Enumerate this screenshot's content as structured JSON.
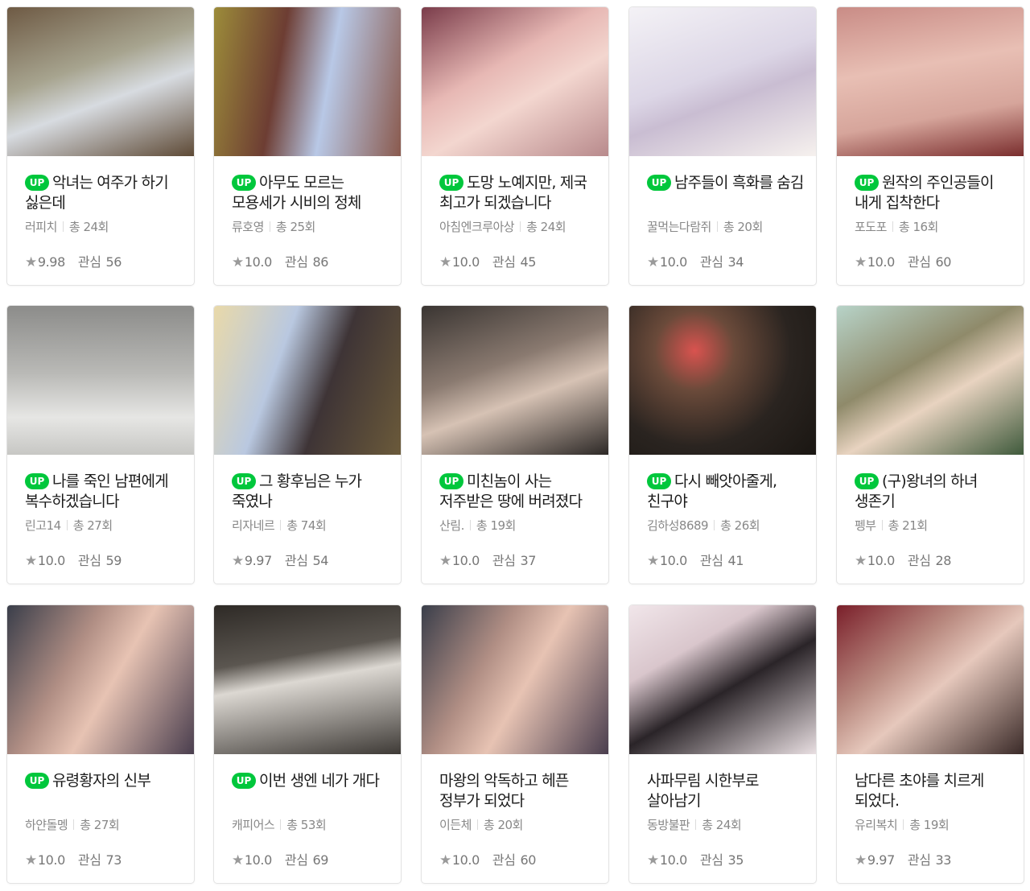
{
  "cards": [
    {
      "up": true,
      "badge": "UP",
      "title": "악녀는 여주가 하기 싫은데",
      "author": "러피치",
      "episodes": "총 24회",
      "rating": "9.98",
      "interest_label": "관심",
      "interest": "56",
      "thumb_gradient": "linear-gradient(160deg,#6e5a44 0%,#a7a48f 40%,#d7dbe0 60%,#5e4a36 100%)"
    },
    {
      "up": true,
      "badge": "UP",
      "title": "아무도 모르는 모용세가 시비의 정체",
      "author": "류호영",
      "episodes": "총 25회",
      "rating": "10.0",
      "interest_label": "관심",
      "interest": "86",
      "thumb_gradient": "linear-gradient(100deg,#9c8c3a 0%,#6d3d33 35%,#b8c8e6 60%,#8a5a4e 100%)"
    },
    {
      "up": true,
      "badge": "UP",
      "title": "도망 노예지만, 제국 최고가 되겠습니다",
      "author": "아침엔크루아상",
      "episodes": "총 24회",
      "rating": "10.0",
      "interest_label": "관심",
      "interest": "45",
      "thumb_gradient": "linear-gradient(150deg,#7a3c4a 0%,#e7b8b4 40%,#f3d6cf 60%,#b88a8c 100%)"
    },
    {
      "up": true,
      "badge": "UP",
      "title": "남주들이 흑화를 숨김",
      "author": "꿀먹는다람쥐",
      "episodes": "총 20회",
      "rating": "10.0",
      "interest_label": "관심",
      "interest": "34",
      "thumb_gradient": "linear-gradient(160deg,#f4f2f6 0%,#dcd6e6 45%,#c9bdd2 60%,#f6f1ee 100%)"
    },
    {
      "up": true,
      "badge": "UP",
      "title": "원작의 주인공들이 내게 집착한다",
      "author": "포도포",
      "episodes": "총 16회",
      "rating": "10.0",
      "interest_label": "관심",
      "interest": "60",
      "thumb_gradient": "linear-gradient(170deg,#c98c86 0%,#e8bfb4 40%,#d6a59b 70%,#7a2e2e 100%)"
    },
    {
      "up": true,
      "badge": "UP",
      "title": "나를 죽인 남편에게 복수하겠습니다",
      "author": "린고14",
      "episodes": "총 27회",
      "rating": "10.0",
      "interest_label": "관심",
      "interest": "59",
      "thumb_gradient": "linear-gradient(180deg,#8c8c8a 0%,#b9b9b6 45%,#e6e6e4 75%,#c7c7c4 100%)"
    },
    {
      "up": true,
      "badge": "UP",
      "title": "그 황후님은 누가 죽였나",
      "author": "리자네르",
      "episodes": "총 74회",
      "rating": "9.97",
      "interest_label": "관심",
      "interest": "54",
      "thumb_gradient": "linear-gradient(110deg,#e9d9a9 0%,#b9c8e0 35%,#3e3436 60%,#6b5a3a 100%)"
    },
    {
      "up": true,
      "badge": "UP",
      "title": "미친놈이 사는 저주받은 땅에 버려졌다",
      "author": "산림.",
      "episodes": "총 19회",
      "rating": "10.0",
      "interest_label": "관심",
      "interest": "37",
      "thumb_gradient": "linear-gradient(160deg,#3a3532 0%,#8a7a70 40%,#d6c2b4 60%,#2c2826 100%)"
    },
    {
      "up": true,
      "badge": "UP",
      "title": "다시 빼앗아줄게, 친구야",
      "author": "김하성8689",
      "episodes": "총 26회",
      "rating": "10.0",
      "interest_label": "관심",
      "interest": "41",
      "thumb_gradient": "radial-gradient(circle at 35% 30%,#d9534f 0%,#6a4a3a 25%,#2a2420 60%,#1a1612 100%)"
    },
    {
      "up": true,
      "badge": "UP",
      "title": "(구)왕녀의 하녀 생존기",
      "author": "펭부",
      "episodes": "총 21회",
      "rating": "10.0",
      "interest_label": "관심",
      "interest": "28",
      "thumb_gradient": "linear-gradient(150deg,#b7d3c8 0%,#8f8a6a 40%,#e8d3c0 60%,#3f5a3c 100%)"
    },
    {
      "up": true,
      "badge": "UP",
      "title": "유령황자의 신부",
      "author": "하얀돌멩",
      "episodes": "총 27회",
      "rating": "10.0",
      "interest_label": "관심",
      "interest": "73",
      "thumb_gradient": "linear-gradient(120deg,#3a3e4a 0%,#b08e84 35%,#e7c3b3 55%,#4a3e4e 100%)"
    },
    {
      "up": true,
      "badge": "UP",
      "title": "이번 생엔 네가 개다",
      "author": "캐피어스",
      "episodes": "총 53회",
      "rating": "10.0",
      "interest_label": "관심",
      "interest": "69",
      "thumb_gradient": "linear-gradient(170deg,#2e2a26 0%,#5b5650 35%,#dcd8d2 50%,#3e3a36 100%)"
    },
    {
      "up": false,
      "badge": "",
      "title": "마왕의 악독하고 헤픈 정부가 되었다",
      "author": "이든체",
      "episodes": "총 20회",
      "rating": "10.0",
      "interest_label": "관심",
      "interest": "60",
      "thumb_gradient": "linear-gradient(120deg,#3a3e4a 0%,#b08e84 35%,#e7c3b3 55%,#4a3e4e 100%)"
    },
    {
      "up": false,
      "badge": "",
      "title": "사파무림 시한부로 살아남기",
      "author": "동방불판",
      "episodes": "총 24회",
      "rating": "10.0",
      "interest_label": "관심",
      "interest": "35",
      "thumb_gradient": "linear-gradient(150deg,#f1e6ea 0%,#d9c6cc 30%,#2a2428 55%,#e9dfe2 100%)"
    },
    {
      "up": false,
      "badge": "",
      "title": "남다른 초야를 치르게 되었다.",
      "author": "유리복치",
      "episodes": "총 19회",
      "rating": "9.97",
      "interest_label": "관심",
      "interest": "33",
      "thumb_gradient": "linear-gradient(140deg,#7a1f2a 0%,#b98a80 35%,#e6c8bc 55%,#3a2a28 100%)"
    }
  ]
}
